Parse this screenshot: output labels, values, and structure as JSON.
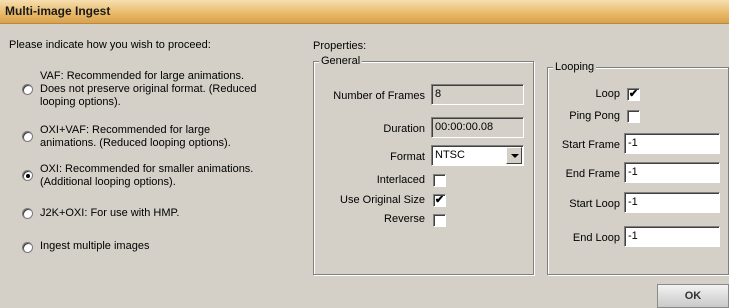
{
  "window": {
    "title": "Multi-image Ingest"
  },
  "instructions": "Please indicate how you wish to proceed:",
  "options": [
    {
      "label_line1": "VAF: Recommended for large animations.",
      "label_line2": "Does not preserve original format. (Reduced",
      "label_line3": "looping options).",
      "selected": false
    },
    {
      "label_line1": "OXI+VAF: Recommended for large",
      "label_line2": "animations. (Reduced looping options).",
      "selected": false
    },
    {
      "label_line1": "OXI: Recommended for smaller animations.",
      "label_line2": "(Additional looping options).",
      "selected": true
    },
    {
      "label_line1": "J2K+OXI: For use with HMP.",
      "selected": false
    },
    {
      "label_line1": "Ingest multiple images",
      "selected": false
    }
  ],
  "properties": {
    "title": "Properties:",
    "general": {
      "title": "General",
      "number_of_frames_label": "Number of Frames",
      "number_of_frames": "8",
      "duration_label": "Duration",
      "duration": "00:00:00.08",
      "format_label": "Format",
      "format": "NTSC",
      "interlaced_label": "Interlaced",
      "interlaced": false,
      "use_original_size_label": "Use Original Size",
      "use_original_size": true,
      "reverse_label": "Reverse",
      "reverse": false
    },
    "looping": {
      "title": "Looping",
      "loop_label": "Loop",
      "loop": true,
      "ping_pong_label": "Ping Pong",
      "ping_pong": false,
      "start_frame_label": "Start Frame",
      "start_frame": "-1",
      "end_frame_label": "End Frame",
      "end_frame": "-1",
      "start_loop_label": "Start Loop",
      "start_loop": "-1",
      "end_loop_label": "End Loop",
      "end_loop": "-1"
    }
  },
  "buttons": {
    "ok": "OK"
  },
  "check_glyph": "✔"
}
